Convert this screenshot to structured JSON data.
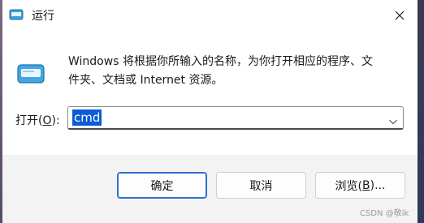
{
  "window": {
    "title": "运行",
    "icon": "run-app-icon",
    "close_icon": "close-icon"
  },
  "description": {
    "line1": "Windows 将根据你所输入的名称，为你打开相应的程序、文",
    "line2": "件夹、文档或 Internet 资源。"
  },
  "open_field": {
    "label_prefix": "打开(",
    "label_accel": "O",
    "label_suffix": "):",
    "value": "cmd",
    "dropdown_icon": "chevron-down-icon"
  },
  "buttons": {
    "ok": "确定",
    "cancel": "取消",
    "browse_prefix": "浏览(",
    "browse_accel": "B",
    "browse_suffix": ")..."
  },
  "watermark": "CSDN @敬ik",
  "colors": {
    "accent": "#0a5bd4",
    "default_button_border": "#2f6fcf"
  }
}
